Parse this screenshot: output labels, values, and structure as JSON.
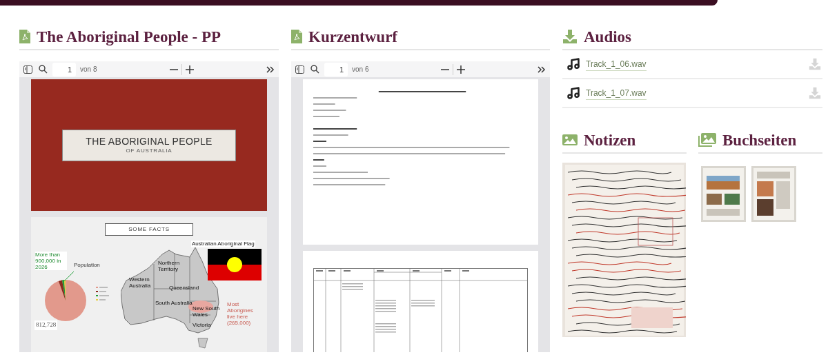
{
  "pdf_viewers": [
    {
      "title": "The Aboriginal People - PP",
      "page": "1",
      "page_count": "von 8",
      "pages": [
        {
          "kind": "title_slide",
          "title": "THE ABORIGINAL PEOPLE",
          "subtitle": "OF AUSTRALIA"
        },
        {
          "kind": "facts_slide",
          "title": "SOME FACTS",
          "callout": "More than 900,000 in 2026",
          "chart_label": "Population",
          "total": "812,728",
          "flag_label": "Australian Aboriginal Flag",
          "regions": [
            "Western Australia",
            "Northern Territory",
            "Queensland",
            "South Australia",
            "New South Wales",
            "Victoria"
          ],
          "note": "Most Aborigines live here (265,000)"
        }
      ]
    },
    {
      "title": "Kurzentwurf",
      "page": "1",
      "page_count": "von 6",
      "pages": [
        {
          "kind": "text_page"
        },
        {
          "kind": "table_page"
        }
      ]
    }
  ],
  "audios": {
    "title": "Audios",
    "files": [
      {
        "name": "Track_1_06.wav"
      },
      {
        "name": "Track_1_07.wav"
      }
    ]
  },
  "notes": {
    "title": "Notizen"
  },
  "book_pages": {
    "title": "Buchseiten"
  }
}
